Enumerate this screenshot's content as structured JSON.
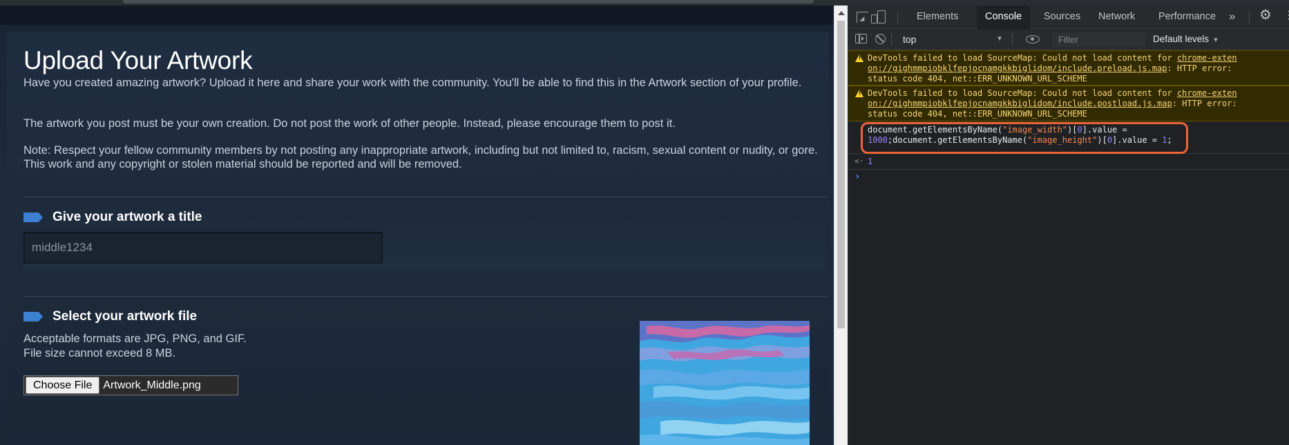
{
  "page": {
    "title": "Upload Your Artwork",
    "intro": "Have you created amazing artwork? Upload it here and share your work with the community. You'll be able to find this in the Artwork section of your profile.",
    "own_creation": "The artwork you post must be your own creation. Do not post the work of other people. Instead, please encourage them to post it.",
    "note": "Note: Respect your fellow community members by not posting any inappropriate artwork, including but not limited to, racism, sexual content or nudity, or gore. This work and any copyright or stolen material should be reported and will be removed.",
    "title_section": {
      "heading": "Give your artwork a title",
      "value": "middle1234"
    },
    "file_section": {
      "heading": "Select your artwork file",
      "formats": "Acceptable formats are JPG, PNG, and GIF.",
      "size_limit": "File size cannot exceed 8 MB.",
      "choose_button": "Choose File",
      "file_name": "Artwork_Middle.png"
    }
  },
  "devtools": {
    "tabs": [
      "Elements",
      "Console",
      "Sources",
      "Network",
      "Performance"
    ],
    "active_tab": "Console",
    "more_label": "»",
    "toolbar": {
      "context": "top",
      "filter_placeholder": "Filter",
      "levels": "Default levels"
    },
    "messages": [
      {
        "type": "warning",
        "line1_prefix": "DevTools failed to load SourceMap: Could not load content for ",
        "line1_link": "chrome-exten",
        "line2_link": "on://gighmmpiobklfepjocnamgkkbiglidom/include.preload.js.map",
        "line2_suffix": ": HTTP error:",
        "line3": "status code 404, net::ERR_UNKNOWN_URL_SCHEME"
      },
      {
        "type": "warning",
        "line1_prefix": "DevTools failed to load SourceMap: Could not load content for ",
        "line1_link": "chrome-exten",
        "line2_link": "on://gighmmpiobklfepjocnamgkkbiglidom/include.postload.js.map",
        "line2_suffix": ": HTTP error:",
        "line3": "status code 404, net::ERR_UNKNOWN_URL_SCHEME"
      }
    ],
    "command": {
      "p1": "document.getElementsByName(",
      "s1": "\"image_width\"",
      "p2": ")[",
      "n1": "0",
      "p3": "].value =",
      "line2_p1": "1000;document.getElementsByName(",
      "s2": "\"image_height\"",
      "line2_p2": ")[",
      "n2": "0",
      "line2_p3": "].value = ",
      "n3": "1",
      "line2_p4": ";"
    },
    "result": "1",
    "highlight_color": "#ed6536"
  }
}
